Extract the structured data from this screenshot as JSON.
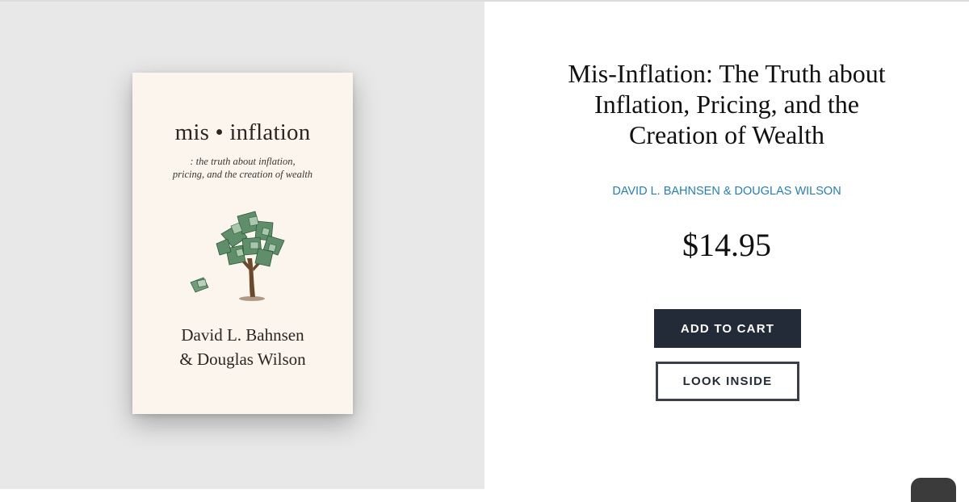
{
  "book_cover": {
    "title": "mis • inflation",
    "subtitle_line1": ": the truth about inflation,",
    "subtitle_line2": "pricing, and the creation of wealth",
    "author_line1": "David L. Bahnsen",
    "author_line2": "& Douglas Wilson",
    "art_icon": "money-tree-icon"
  },
  "product": {
    "title_line1": "Mis-Inflation: The Truth about",
    "title_line2": "Inflation, Pricing, and the",
    "title_line3": "Creation of Wealth",
    "authors": "DAVID L. BAHNSEN & DOUGLAS WILSON",
    "price": "$14.95"
  },
  "actions": {
    "add_to_cart_label": "ADD TO CART",
    "look_inside_label": "LOOK INSIDE"
  },
  "widgets": {
    "chat_icon": "chat-widget-icon"
  },
  "colors": {
    "left_panel_bg": "#e8e8e8",
    "cover_bg": "#fbf5ee",
    "author_link": "#1f7fc0",
    "primary_button": "#232a38"
  }
}
